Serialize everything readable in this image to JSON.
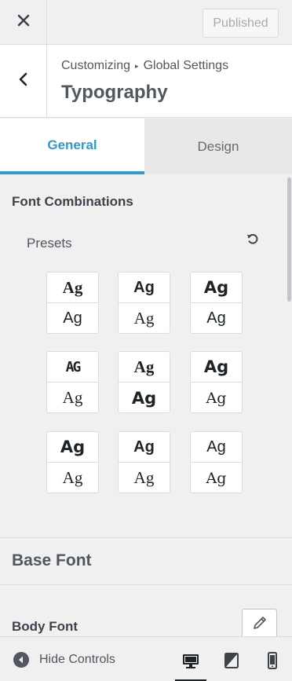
{
  "topbar": {
    "close_icon": "close-icon",
    "publish_label": "Published"
  },
  "section": {
    "breadcrumb_parent": "Customizing",
    "breadcrumb_separator": "▸",
    "breadcrumb_child": "Global Settings",
    "title": "Typography",
    "back_icon": "chevron-left-icon"
  },
  "tabs": [
    {
      "label": "General",
      "active": true
    },
    {
      "label": "Design",
      "active": false
    }
  ],
  "font_combinations": {
    "heading": "Font Combinations",
    "presets_label": "Presets",
    "reset_icon": "undo-icon",
    "presets": [
      {
        "top": "Ag",
        "bottom": "Ag"
      },
      {
        "top": "Ag",
        "bottom": "Ag"
      },
      {
        "top": "Ag",
        "bottom": "Ag"
      },
      {
        "top": "AG",
        "bottom": "Ag"
      },
      {
        "top": "Ag",
        "bottom": "Ag"
      },
      {
        "top": "Ag",
        "bottom": "Ag"
      },
      {
        "top": "Ag",
        "bottom": "Ag"
      },
      {
        "top": "Ag",
        "bottom": "Ag"
      },
      {
        "top": "Ag",
        "bottom": "Ag"
      }
    ]
  },
  "base_font": {
    "title": "Base Font",
    "body_font_label": "Body Font",
    "edit_icon": "pencil-icon"
  },
  "footer": {
    "hide_controls_label": "Hide Controls",
    "devices": [
      "desktop-icon",
      "tablet-icon",
      "mobile-icon"
    ],
    "active_device": "desktop"
  },
  "colors": {
    "accent": "#2e9bcf",
    "text": "#50575e",
    "background": "#f0f0f1",
    "border": "#dcdcde"
  }
}
